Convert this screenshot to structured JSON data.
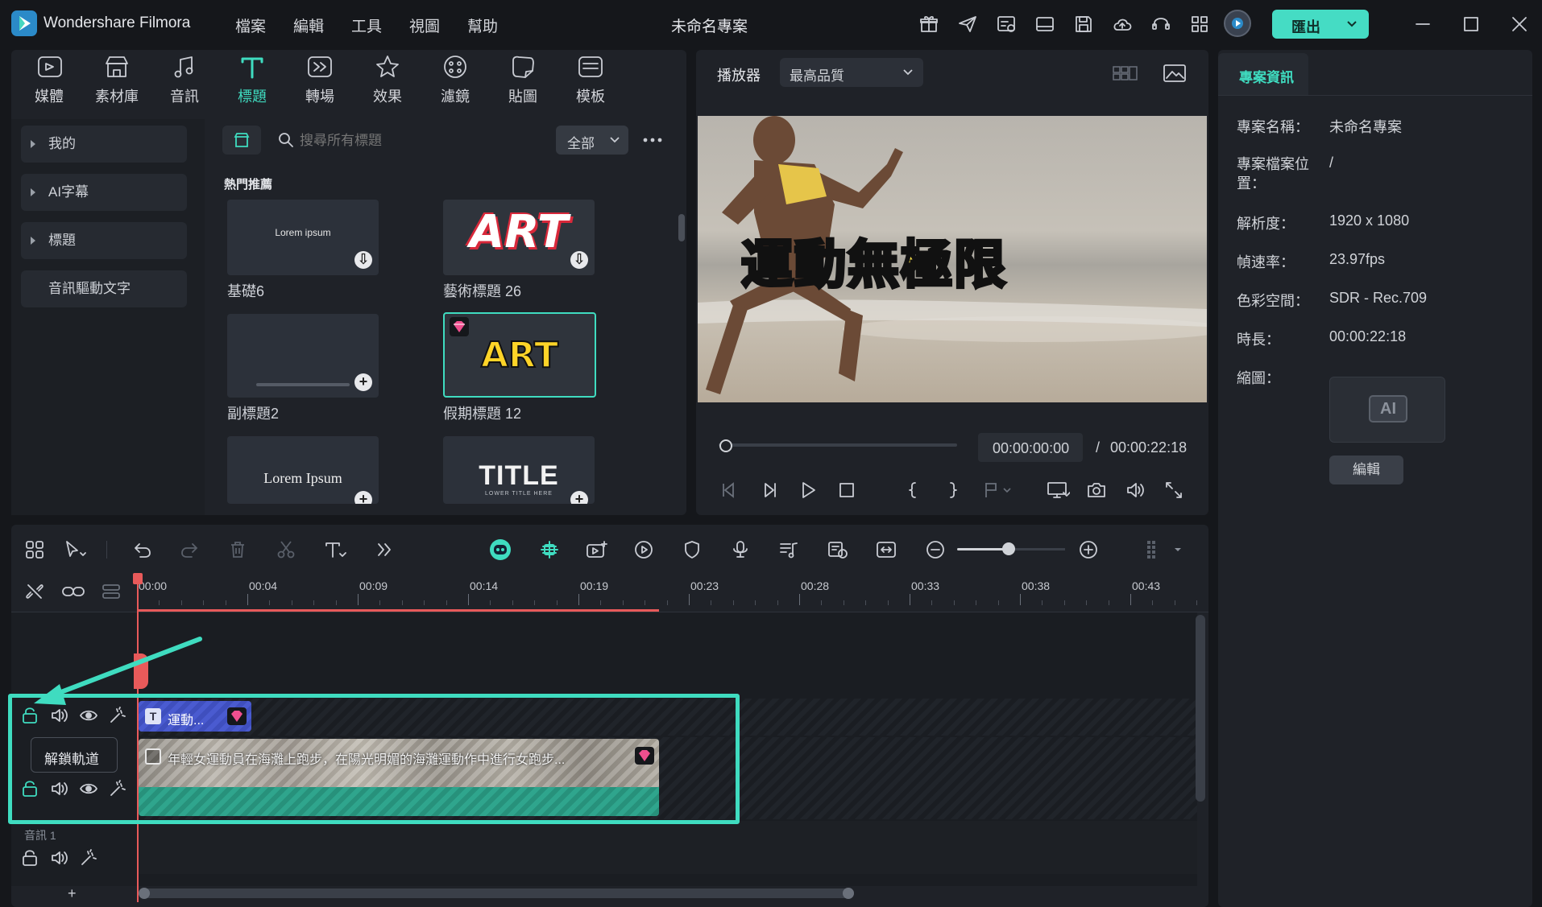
{
  "app": {
    "name": "Wondershare Filmora",
    "project_title": "未命名專案",
    "export_label": "匯出"
  },
  "menu": [
    "檔案",
    "編輯",
    "工具",
    "視圖",
    "幫助"
  ],
  "toolbar": [
    {
      "label": "媒體",
      "icon": "media-icon"
    },
    {
      "label": "素材庫",
      "icon": "stock-icon"
    },
    {
      "label": "音訊",
      "icon": "music-icon"
    },
    {
      "label": "標題",
      "icon": "title-t-icon",
      "active": true
    },
    {
      "label": "轉場",
      "icon": "transition-icon"
    },
    {
      "label": "效果",
      "icon": "effects-icon"
    },
    {
      "label": "濾鏡",
      "icon": "filter-icon"
    },
    {
      "label": "貼圖",
      "icon": "sticker-icon"
    },
    {
      "label": "模板",
      "icon": "template-icon"
    }
  ],
  "sidebar": [
    "我的",
    "AI字幕",
    "標題",
    "音訊驅動文字"
  ],
  "library": {
    "search_placeholder": "搜尋所有標題",
    "filter": "全部",
    "section": "熱門推薦",
    "cards": [
      {
        "label": "基礎6",
        "thumb": "Lorem ipsum"
      },
      {
        "label": "藝術標題 26",
        "thumb": "ART"
      },
      {
        "label": "副標題2",
        "thumb": ""
      },
      {
        "label": "假期標題 12",
        "thumb": "ART"
      },
      {
        "label": "",
        "thumb": "Lorem Ipsum"
      },
      {
        "label": "",
        "thumb": "TITLE",
        "sub": "LOWER TITLE HERE"
      }
    ]
  },
  "player": {
    "tab": "播放器",
    "quality": "最高品質",
    "overlay_text": "運動無極限",
    "current_time": "00:00:00:00",
    "separator": "/",
    "total_time": "00:00:22:18",
    "progress": 0
  },
  "project_info": {
    "tab": "專案資訊",
    "rows": [
      {
        "label": "專案名稱：",
        "value": "未命名專案"
      },
      {
        "label": "專案檔案位置：",
        "value": "/"
      },
      {
        "label": "解析度：",
        "value": "1920 x 1080"
      },
      {
        "label": "幀速率：",
        "value": "23.97fps"
      },
      {
        "label": "色彩空間：",
        "value": "SDR - Rec.709"
      },
      {
        "label": "時長：",
        "value": "00:00:22:18"
      },
      {
        "label": "縮圖：",
        "value": ""
      }
    ],
    "thumb_text": "AI",
    "edit_button": "編輯"
  },
  "timeline": {
    "ticks": [
      "00:00",
      "00:04",
      "00:09",
      "00:14",
      "00:19",
      "00:23",
      "00:28",
      "00:33",
      "00:38",
      "00:43"
    ],
    "title_clip": "運動...",
    "video_clip": "年輕女運動員在海灘上跑步，在陽光明媚的海灘運動作中進行女跑步...",
    "tooltip": "解鎖軌道",
    "audio_track": "音訊 1",
    "add": "+"
  },
  "colors": {
    "accent": "#3fdcc0",
    "highlight_box": "#3fdcc0",
    "playhead": "#e85a5a",
    "title_clip": "#4a5bd0"
  }
}
